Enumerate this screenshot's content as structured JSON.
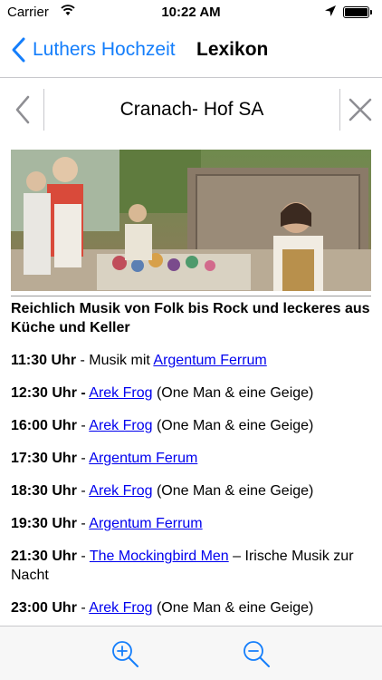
{
  "status": {
    "carrier": "Carrier",
    "time": "10:22 AM"
  },
  "nav": {
    "back_label": "Luthers Hochzeit",
    "title": "Lexikon"
  },
  "doc": {
    "title": "Cranach- Hof SA"
  },
  "content": {
    "heading": "Reichlich Musik von Folk bis Rock und leckeres aus Küche und Keller",
    "entries": [
      {
        "time": "11:30 Uhr",
        "sep": " - Musik mit ",
        "link": "Argentum Ferrum",
        "rest": ""
      },
      {
        "time": "12:30 Uhr -",
        "sep": " ",
        "link": "Arek Frog",
        "rest": " (One Man & eine Geige)"
      },
      {
        "time": "16:00 Uhr",
        "sep": " - ",
        "link": "Arek Frog",
        "rest": " (One Man & eine Geige)"
      },
      {
        "time": "17:30 Uhr",
        "sep": " - ",
        "link": "Argentum Ferum",
        "rest": ""
      },
      {
        "time": "18:30 Uhr",
        "sep": " - ",
        "link": "Arek Frog",
        "rest": " (One Man & eine Geige)"
      },
      {
        "time": "19:30 Uhr",
        "sep": " - ",
        "link": "Argentum Ferrum",
        "rest": ""
      },
      {
        "time": "21:30 Uhr",
        "sep": " - ",
        "link": "The Mockingbird Men",
        "rest": " – Irische Musik zur Nacht"
      },
      {
        "time": "23:00 Uhr",
        "sep": " - ",
        "link": "Arek Frog",
        "rest": " (One Man & eine Geige)"
      }
    ]
  },
  "colors": {
    "ios_blue": "#147efb",
    "link": "#0000ee"
  },
  "icons": {
    "back": "chevron-left-icon",
    "prev": "chevron-left-icon",
    "close": "close-icon",
    "zoom_in": "zoom-in-icon",
    "zoom_out": "zoom-out-icon"
  }
}
